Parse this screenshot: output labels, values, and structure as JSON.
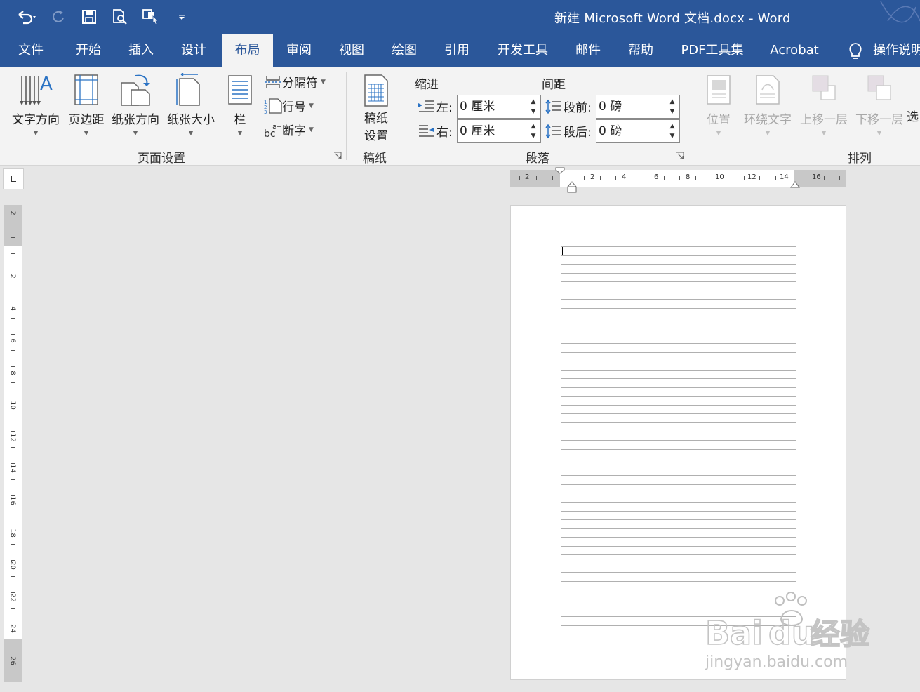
{
  "titlebar": {
    "title": "新建 Microsoft Word 文档.docx  -  Word",
    "qat": [
      {
        "name": "undo-icon"
      },
      {
        "name": "redo-icon"
      },
      {
        "name": "save-icon"
      },
      {
        "name": "print-preview-icon"
      },
      {
        "name": "touch-mode-icon"
      },
      {
        "name": "customize-qat-icon"
      }
    ]
  },
  "tabs": [
    {
      "label": "文件"
    },
    {
      "label": "开始"
    },
    {
      "label": "插入"
    },
    {
      "label": "设计"
    },
    {
      "label": "布局",
      "active": true
    },
    {
      "label": "审阅"
    },
    {
      "label": "视图"
    },
    {
      "label": "绘图"
    },
    {
      "label": "引用"
    },
    {
      "label": "开发工具"
    },
    {
      "label": "邮件"
    },
    {
      "label": "帮助"
    },
    {
      "label": "PDF工具集"
    },
    {
      "label": "Acrobat"
    },
    {
      "label": "操作说明"
    }
  ],
  "ribbon": {
    "page_setup": {
      "text_direction": "文字方向",
      "margins": "页边距",
      "orientation": "纸张方向",
      "size": "纸张大小",
      "columns": "栏",
      "breaks": "分隔符",
      "line_numbers": "行号",
      "hyphenation": "断字",
      "group_label": "页面设置"
    },
    "manuscript": {
      "btn_line1": "稿纸",
      "btn_line2": "设置",
      "group_label": "稿纸"
    },
    "paragraph": {
      "indent_title": "缩进",
      "spacing_title": "间距",
      "left_label": "左:",
      "left_value": "0 厘米",
      "right_label": "右:",
      "right_value": "0 厘米",
      "before_label": "段前:",
      "before_value": "0 磅",
      "after_label": "段后:",
      "after_value": "0 磅",
      "group_label": "段落"
    },
    "arrange": {
      "position": "位置",
      "wrap_text": "环绕文字",
      "bring_forward": "上移一层",
      "send_backward": "下移一层",
      "selection_pane": "选",
      "group_label": "排列"
    }
  },
  "hruler": {
    "labels": [
      "2",
      "2",
      "4",
      "6",
      "8",
      "10",
      "12",
      "14",
      "16"
    ]
  },
  "vruler": {
    "labels": [
      "2",
      "2",
      "4",
      "6",
      "8",
      "10",
      "12",
      "14",
      "16",
      "18",
      "20",
      "22",
      "24",
      "26"
    ]
  },
  "watermark": {
    "brand": "Bai",
    "brand2": "du",
    "cn": "经验",
    "url": "jingyan.baidu.com"
  },
  "colors": {
    "title_bar": "#2b579a",
    "ribbon": "#f3f3f3",
    "workspace": "#e6e6e6"
  }
}
